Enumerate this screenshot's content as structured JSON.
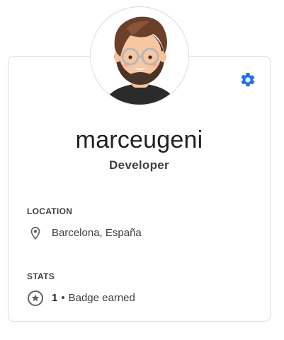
{
  "profile": {
    "username": "marceugeni",
    "role": "Developer"
  },
  "location": {
    "heading": "LOCATION",
    "value": "Barcelona, España",
    "icon": "location-pin-icon"
  },
  "stats": {
    "heading": "STATS",
    "count": "1",
    "separator": "•",
    "label": "Badge earned",
    "icon": "star-badge-icon"
  },
  "colors": {
    "accent": "#1a73e8",
    "border": "#dadce0",
    "text_primary": "#202124",
    "text_secondary": "#3c4043"
  }
}
